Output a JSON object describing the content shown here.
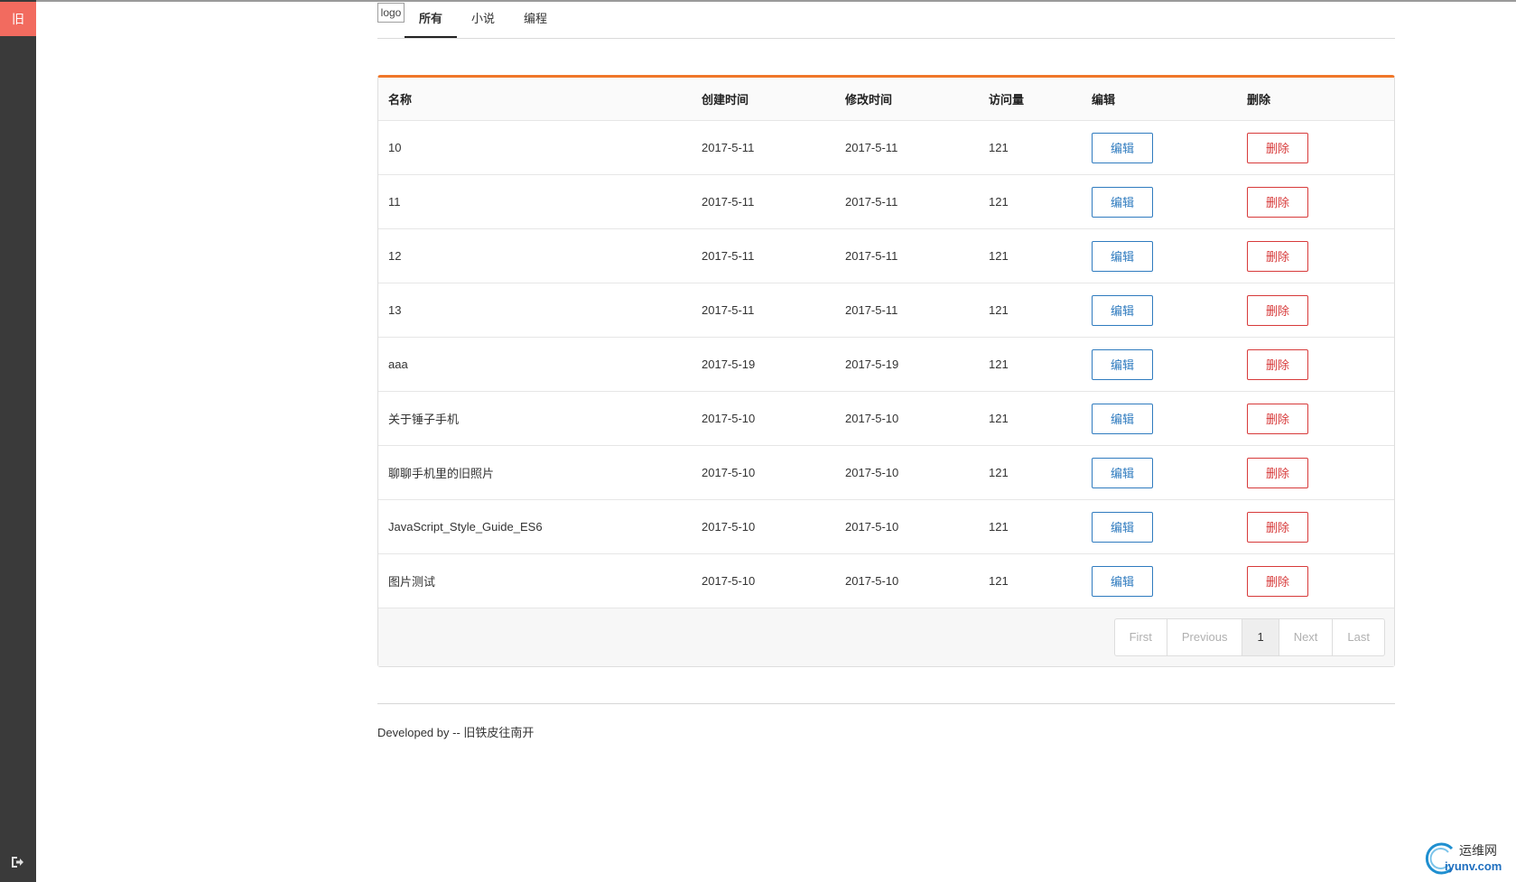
{
  "sidebar": {
    "logo_text": "旧",
    "exit_icon": "sign-out-icon"
  },
  "header": {
    "logo_text": "logo",
    "tabs": [
      {
        "label": "所有",
        "active": true
      },
      {
        "label": "小说",
        "active": false
      },
      {
        "label": "编程",
        "active": false
      }
    ]
  },
  "table": {
    "columns": [
      "名称",
      "创建时间",
      "修改时间",
      "访问量",
      "编辑",
      "删除"
    ],
    "edit_label": "编辑",
    "delete_label": "删除",
    "rows": [
      {
        "name": "10",
        "created": "2017-5-11",
        "modified": "2017-5-11",
        "visits": "121"
      },
      {
        "name": "11",
        "created": "2017-5-11",
        "modified": "2017-5-11",
        "visits": "121"
      },
      {
        "name": "12",
        "created": "2017-5-11",
        "modified": "2017-5-11",
        "visits": "121"
      },
      {
        "name": "13",
        "created": "2017-5-11",
        "modified": "2017-5-11",
        "visits": "121"
      },
      {
        "name": "aaa",
        "created": "2017-5-19",
        "modified": "2017-5-19",
        "visits": "121"
      },
      {
        "name": "关于锤子手机",
        "created": "2017-5-10",
        "modified": "2017-5-10",
        "visits": "121"
      },
      {
        "name": "聊聊手机里的旧照片",
        "created": "2017-5-10",
        "modified": "2017-5-10",
        "visits": "121"
      },
      {
        "name": "JavaScript_Style_Guide_ES6",
        "created": "2017-5-10",
        "modified": "2017-5-10",
        "visits": "121"
      },
      {
        "name": "图片测试",
        "created": "2017-5-10",
        "modified": "2017-5-10",
        "visits": "121"
      }
    ]
  },
  "pagination": {
    "first": "First",
    "previous": "Previous",
    "current": "1",
    "next": "Next",
    "last": "Last"
  },
  "footer": {
    "credit": "Developed by -- 旧铁皮往南开"
  },
  "watermark": {
    "text_cn": "运维网",
    "text_en": "iyunv.com"
  },
  "colors": {
    "accent": "#f0772a",
    "sidebar": "#3a3a3a",
    "logo_bg": "#f26b5f",
    "edit": "#2f7bbf",
    "delete": "#d73a3a"
  }
}
